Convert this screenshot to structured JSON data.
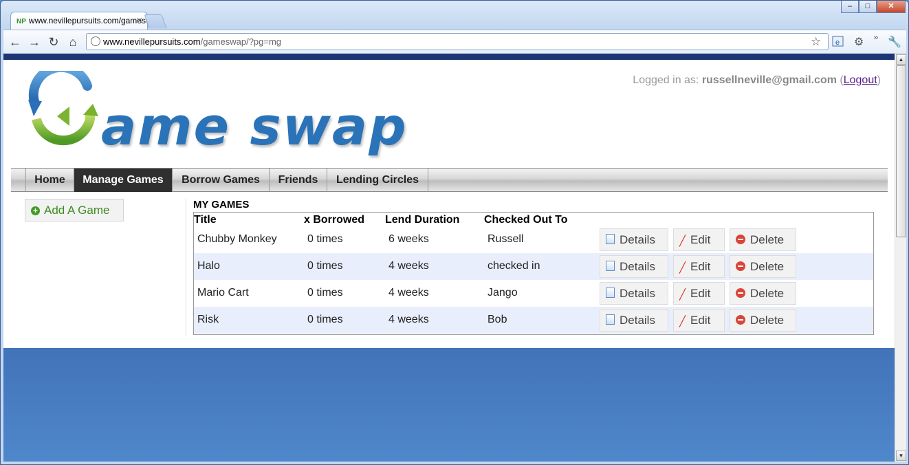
{
  "browser": {
    "tab_title": "www.nevillepursuits.com/gameswap/?pg=mg",
    "favicon_text": "NP",
    "url_host": "www.nevillepursuits.com",
    "url_path": "/gameswap/?pg=mg",
    "window_controls": {
      "minimize": "–",
      "maximize": "□",
      "close": "✕"
    },
    "overflow_label": "»"
  },
  "header": {
    "logo_text": "ame swap",
    "logged_in_prefix": "Logged in as: ",
    "email": "russellneville@gmail.com",
    "logout_open": " (",
    "logout_label": "Logout",
    "logout_close": ")"
  },
  "nav": {
    "items": [
      {
        "label": "Home",
        "active": false
      },
      {
        "label": "Manage Games",
        "active": true
      },
      {
        "label": "Borrow Games",
        "active": false
      },
      {
        "label": "Friends",
        "active": false
      },
      {
        "label": "Lending Circles",
        "active": false
      }
    ]
  },
  "sidebar": {
    "add_game_label": "Add A Game"
  },
  "games": {
    "section_title": "MY GAMES",
    "columns": [
      "Title",
      "x Borrowed",
      "Lend Duration",
      "Checked Out To"
    ],
    "rows": [
      {
        "title": "Chubby Monkey",
        "borrowed": "0 times",
        "duration": "6 weeks",
        "checked_out_to": "Russell"
      },
      {
        "title": "Halo",
        "borrowed": "0 times",
        "duration": "4 weeks",
        "checked_out_to": "checked in"
      },
      {
        "title": "Mario Cart",
        "borrowed": "0 times",
        "duration": "4 weeks",
        "checked_out_to": "Jango"
      },
      {
        "title": "Risk",
        "borrowed": "0 times",
        "duration": "4 weeks",
        "checked_out_to": "Bob"
      }
    ],
    "actions": {
      "details": "Details",
      "edit": "Edit",
      "delete": "Delete"
    }
  },
  "colors": {
    "brand_blue": "#2a73b8",
    "top_bar": "#1d3575",
    "nav_active": "#2f2f2f",
    "add_green": "#3d8c1e",
    "row_alt": "#e8eefc"
  }
}
